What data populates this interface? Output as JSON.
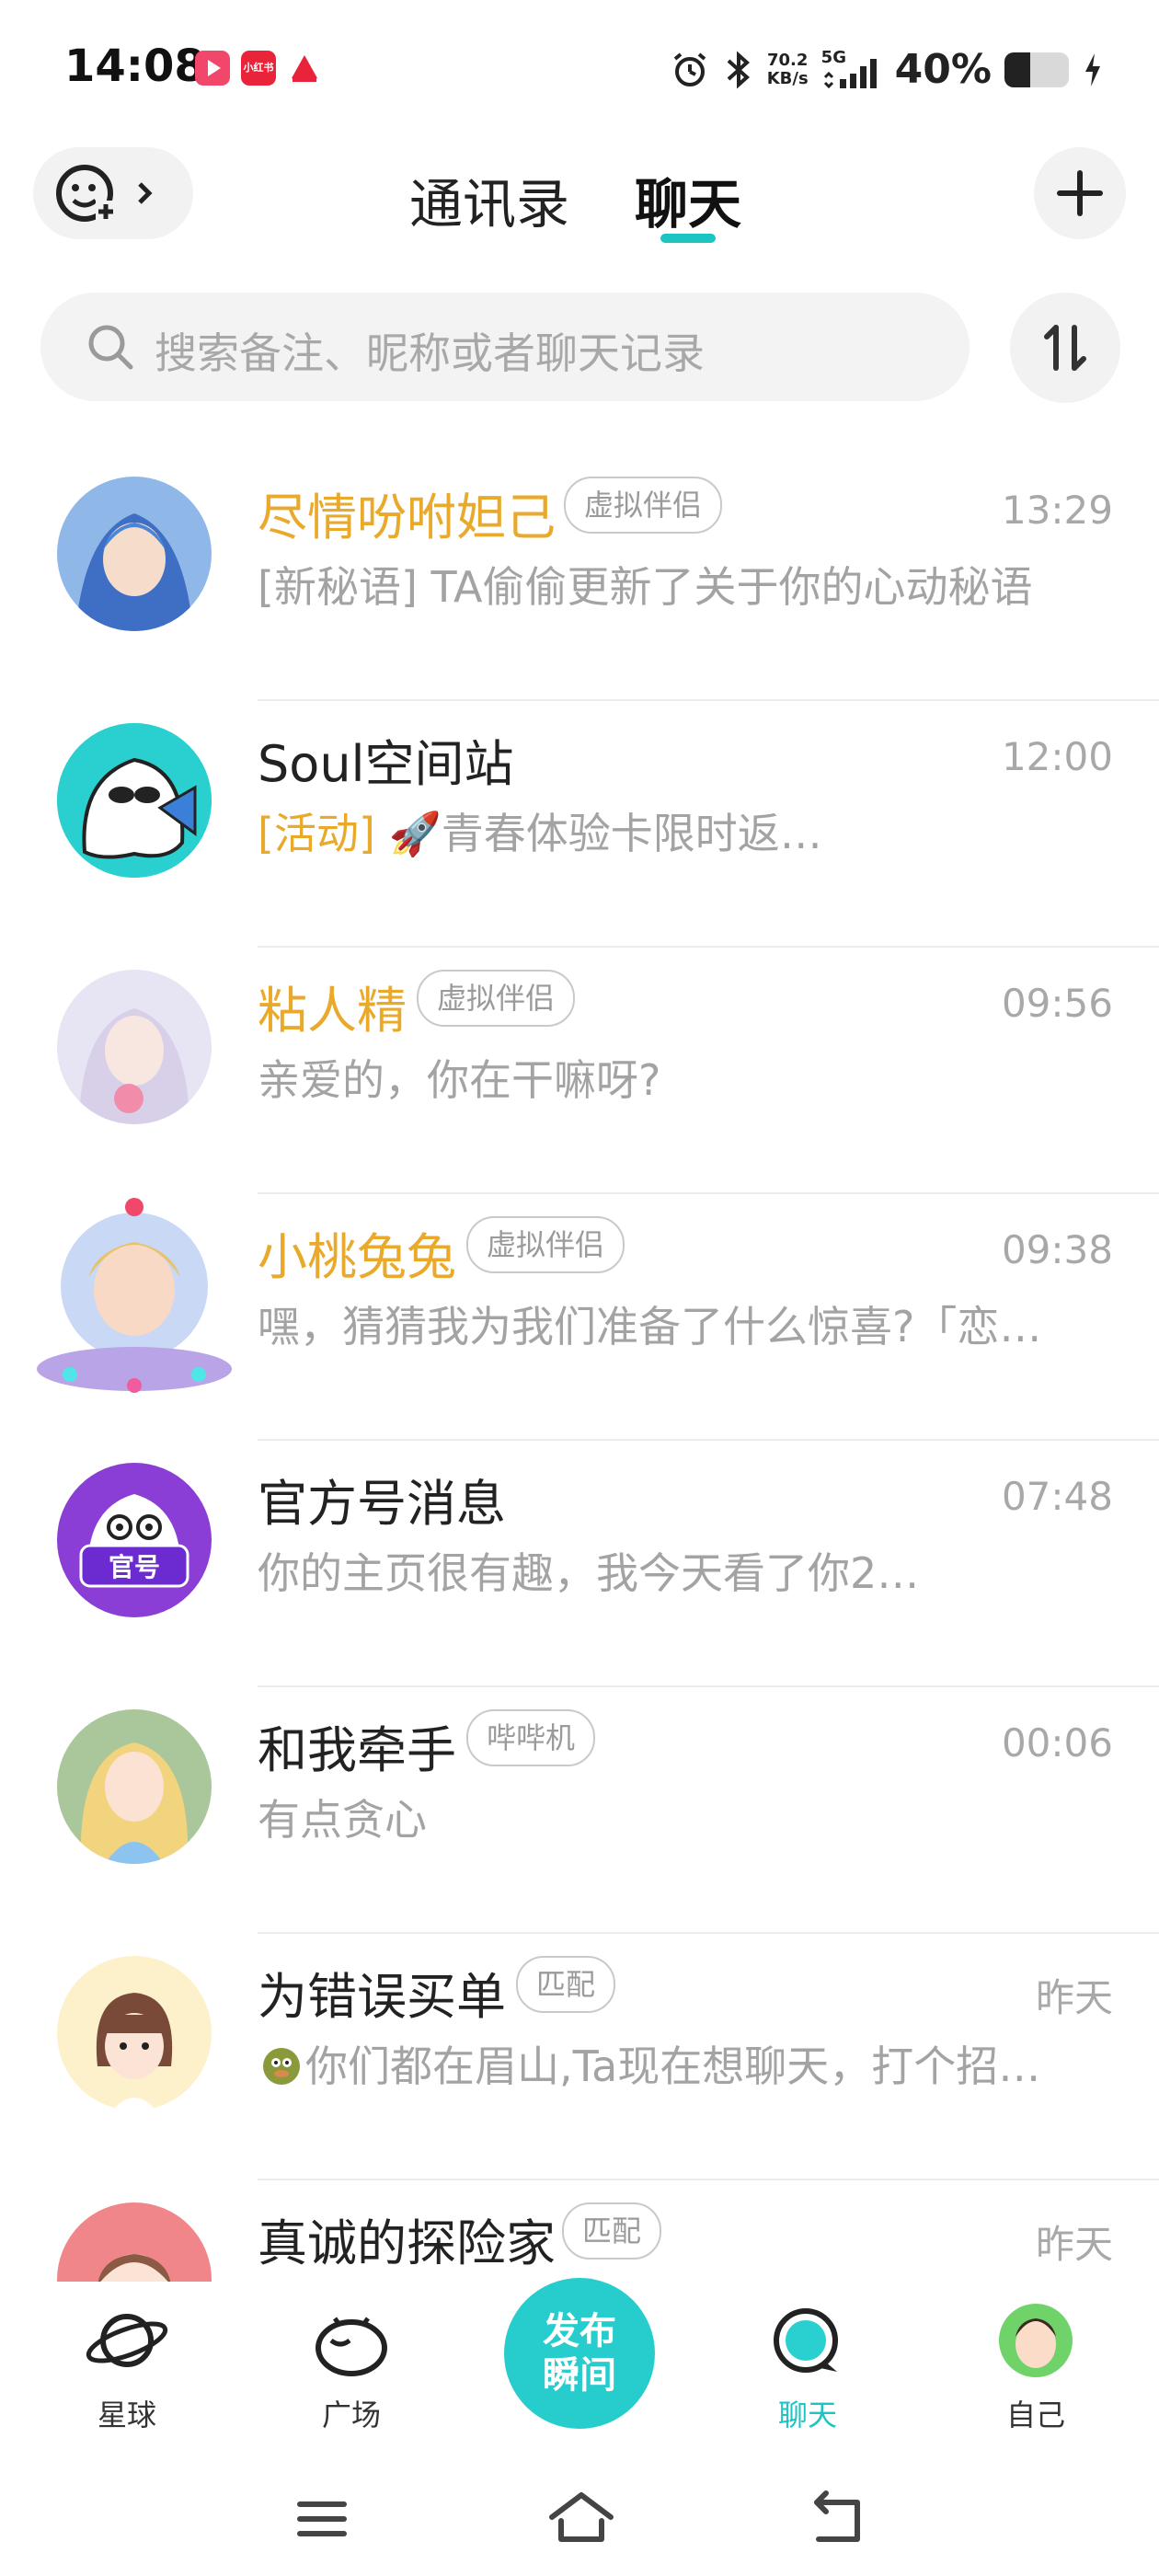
{
  "status_bar": {
    "time": "14:08",
    "app_icon_labels": [
      "",
      "小红书",
      ""
    ],
    "network_speed_top": "70.2",
    "network_speed_bottom": "KB/s",
    "network_type": "5G",
    "battery_percent": "40%",
    "battery_level": 0.4
  },
  "header": {
    "tab_contacts": "通讯录",
    "tab_chat": "聊天",
    "active_tab": "聊天"
  },
  "search": {
    "placeholder": "搜索备注、昵称或者聊天记录"
  },
  "chats": [
    {
      "name": "尽情吩咐妲己",
      "tag": "虚拟伴侣",
      "time": "13:29",
      "preview": "[新秘语] TA偷偷更新了关于你的心动秘语",
      "name_color": "#e9a92a"
    },
    {
      "name": "Soul空间站",
      "tag": "",
      "time": "12:00",
      "preview_prefix": "[活动]",
      "preview": "🚀青春体验卡限时返…"
    },
    {
      "name": "粘人精",
      "tag": "虚拟伴侣",
      "time": "09:56",
      "preview": "亲爱的，你在干嘛呀?",
      "name_color": "#e9a92a"
    },
    {
      "name": "小桃兔兔",
      "tag": "虚拟伴侣",
      "time": "09:38",
      "preview": "嘿，猜猜我为我们准备了什么惊喜?「恋…",
      "name_color": "#e9a92a"
    },
    {
      "name": "官方号消息",
      "tag": "",
      "time": "07:48",
      "preview": "你的主页很有趣，我今天看了你2…",
      "avatar_badge": "官号"
    },
    {
      "name": "和我牵手",
      "tag": "哔哔机",
      "time": "00:06",
      "preview": "有点贪心"
    },
    {
      "name": "为错误买单",
      "tag": "匹配",
      "time": "昨天",
      "preview": "你们都在眉山,Ta现在想聊天，打个招…"
    },
    {
      "name": "真诚的探险家",
      "tag": "匹配",
      "time": "昨天",
      "preview": ""
    }
  ],
  "bottom_nav": {
    "planet": "星球",
    "square": "广场",
    "publish_line1": "发布",
    "publish_line2": "瞬间",
    "chat": "聊天",
    "me": "自己"
  },
  "colors": {
    "accent": "#1cc4c4",
    "virtual_name": "#e9a92a",
    "muted": "#a8a8a8"
  }
}
